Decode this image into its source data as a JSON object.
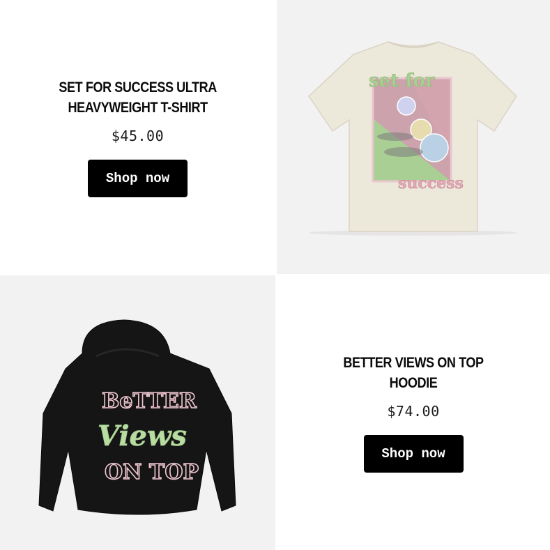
{
  "products": [
    {
      "title_line1": "SET FOR SUCCESS ULTRA",
      "title_line2": "HEAVYWEIGHT T-SHIRT",
      "price": "$45.00",
      "button_label": "Shop now",
      "graphic_text_top": "set for",
      "graphic_text_bottom": "success"
    },
    {
      "title_line1": "BETTER VIEWS ON TOP",
      "title_line2": "HOODIE",
      "price": "$74.00",
      "button_label": "Shop now",
      "graphic_text_1": "BeTTER",
      "graphic_text_2": "Views",
      "graphic_text_3": "ON TOP"
    }
  ],
  "colors": {
    "button_bg": "#000000",
    "tshirt": "#ece8da",
    "hoodie": "#151515",
    "pink": "#d9a6b3",
    "green": "#b5d7a0"
  }
}
